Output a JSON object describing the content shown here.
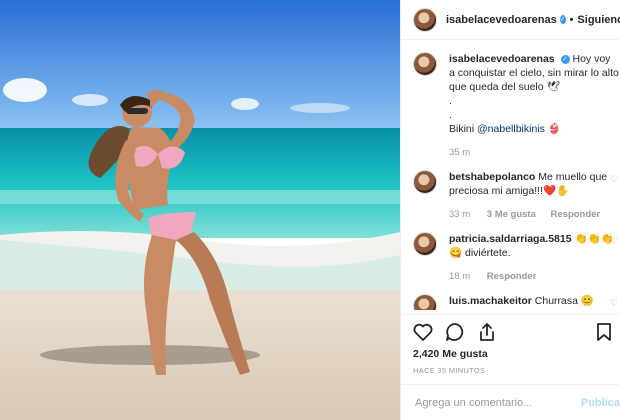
{
  "header": {
    "username": "isabelacevedoarenas",
    "follow_label": "Siguiendo",
    "separator": "•"
  },
  "caption": {
    "username": "isabelacevedoarenas",
    "text": "Hoy voy a conquistar el cielo, sin mirar lo alto que queda del suelo 🕊",
    "dot1": ".",
    "dot2": ".",
    "bikini_label": "Bikini",
    "bikini_mention": "@nabellbikinis 👙",
    "time": "35 m"
  },
  "comments": [
    {
      "username": "betshabepolanco",
      "text": "Me muello que preciosa mi amiga!!!❤️✋",
      "time": "33 m",
      "likes": "3 Me gusta",
      "reply": "Responder"
    },
    {
      "username": "patricia.saldarriaga.5815",
      "text": "👏👏👏 😋 diviértete.",
      "time": "18 m",
      "reply": "Responder"
    },
    {
      "username": "luis.machakeitor",
      "text": "Churrasa 😊"
    }
  ],
  "post": {
    "likes": "2,420 Me gusta",
    "time_ago": "HACE 35 MINUTOS"
  },
  "comment_box": {
    "placeholder": "Agrega un comentario...",
    "publish_label": "Publica"
  },
  "icons": [
    "heart-icon",
    "comment-icon",
    "share-icon",
    "bookmark-icon",
    "verified-icon",
    "more-icon"
  ],
  "colors": {
    "link": "#003569",
    "verified": "#3897f0",
    "muted": "#999999",
    "publish": "#b3dbff"
  }
}
